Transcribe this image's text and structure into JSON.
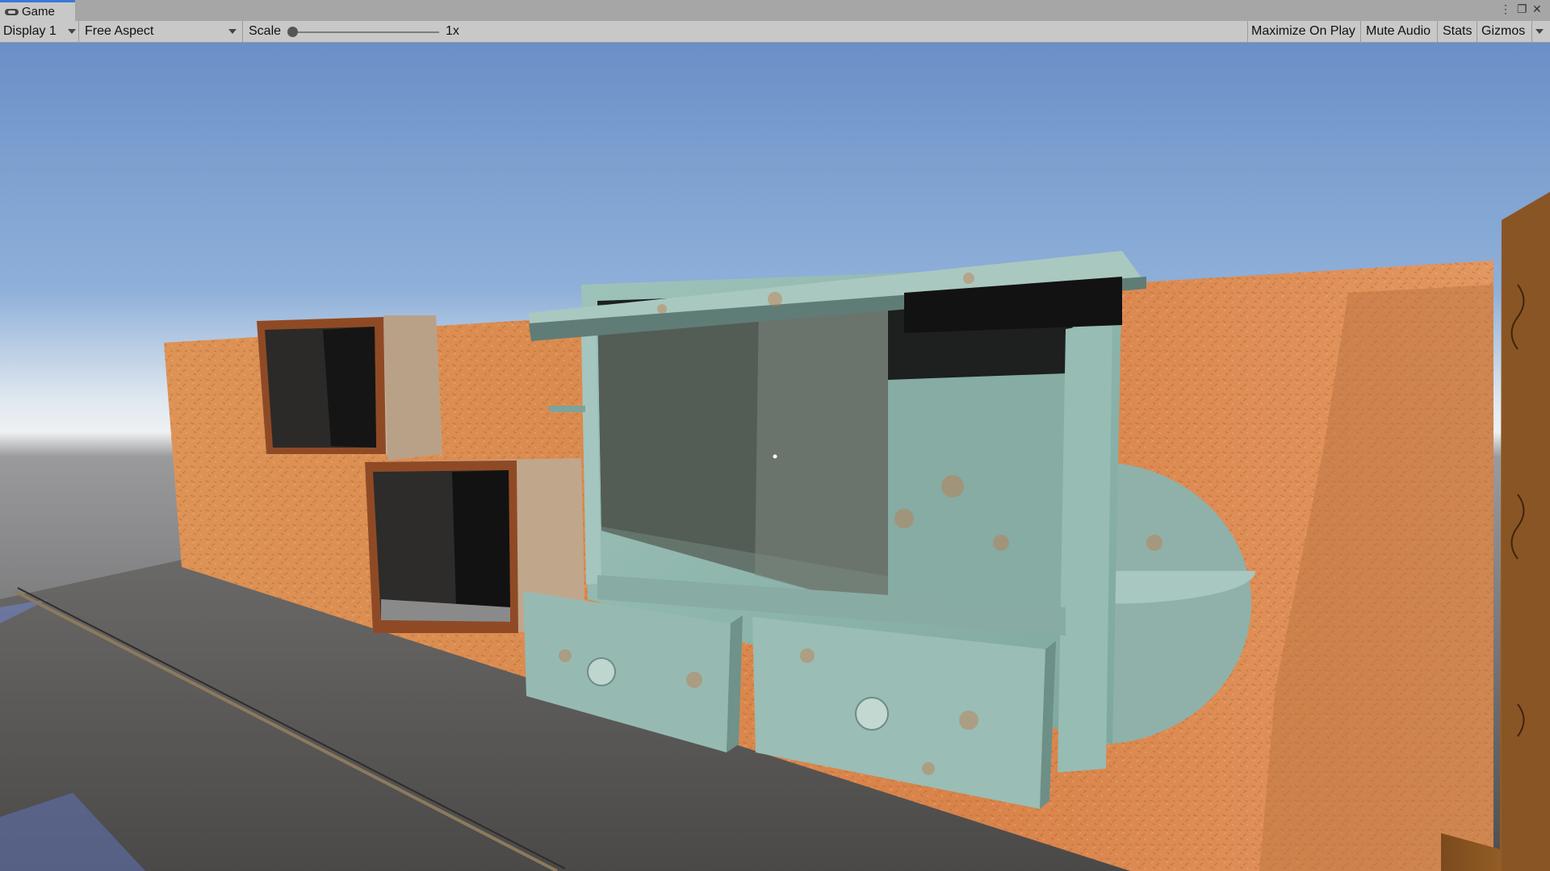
{
  "window": {
    "tab_title": "Game",
    "tab_icon": "gamepad-icon",
    "controls": [
      "more-icon",
      "maximize-icon",
      "close-icon"
    ]
  },
  "toolbar": {
    "display_label": "Display 1",
    "aspect_label": "Free Aspect",
    "scale_label": "Scale",
    "scale_value": "1x",
    "scale_level": 0,
    "maximize_label": "Maximize On Play",
    "mute_label": "Mute Audio",
    "stats_label": "Stats",
    "gizmos_label": "Gizmos"
  },
  "scene": {
    "sky_top": "#6e93c9",
    "sky_horizon": "#e9eef2",
    "wall_color": "#d4854f",
    "cabinet_color": "#8fb6ad",
    "floor_color": "#5b5a58"
  }
}
